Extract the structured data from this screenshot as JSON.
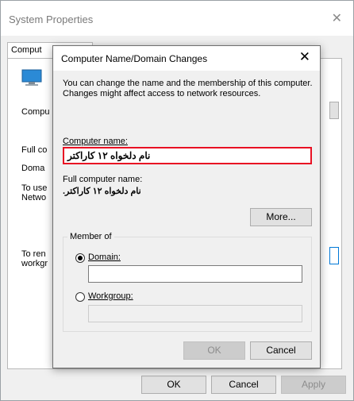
{
  "system_properties": {
    "title": "System Properties",
    "close_glyph": "✕",
    "tab_label": "Comput",
    "labels": {
      "comp": "Compu",
      "full": "Full co",
      "domain": "Doma",
      "touse": "To use",
      "netwo": "Netwo",
      "toren": "To ren",
      "workg": "workgr"
    },
    "buttons": {
      "ok": "OK",
      "cancel": "Cancel",
      "apply": "Apply"
    }
  },
  "dialog": {
    "title": "Computer Name/Domain Changes",
    "close_glyph": "✕",
    "description": "You can change the name and the membership of this computer. Changes might affect access to network resources.",
    "computer_name_label": "Computer name:",
    "computer_name_value": "نام دلخواه ۱۲ کاراکتر",
    "full_computer_name_label": "Full computer name:",
    "full_computer_name_value": "نام دلخواه ۱۲ کاراکتر.",
    "more_button": "More...",
    "member_of_label": "Member of",
    "domain_radio": "Domain:",
    "workgroup_radio": "Workgroup:",
    "ok_button": "OK",
    "cancel_button": "Cancel"
  },
  "colors": {
    "accent": "#0078d7",
    "error_border": "#e81123"
  },
  "icons": {
    "computer": "computer-icon",
    "close": "close-icon"
  }
}
